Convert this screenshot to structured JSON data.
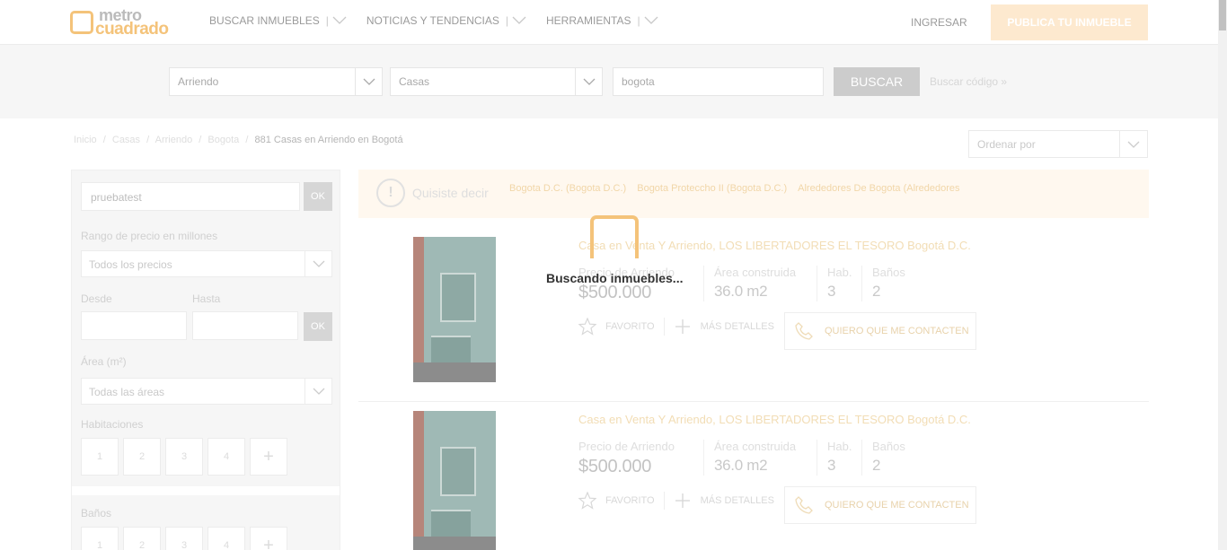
{
  "header": {
    "logo_top": "metro",
    "logo_bottom": "cuadrado",
    "nav": [
      "BUSCAR INMUEBLES",
      "NOTICIAS Y TENDENCIAS",
      "HERRAMIENTAS"
    ],
    "login": "INGRESAR",
    "publish": "PUBLICA TU INMUEBLE"
  },
  "search": {
    "operation": "Arriendo",
    "type": "Casas",
    "location": "bogota",
    "button": "BUSCAR",
    "code_link": "Buscar código »"
  },
  "breadcrumb": [
    "Inicio",
    "/",
    "Casas",
    "/",
    "Arriendo",
    "/",
    "Bogota",
    "/"
  ],
  "breadcrumb_current": "881 Casas en Arriendo en Bogotá",
  "sort": {
    "placeholder": "Ordenar por"
  },
  "filters": {
    "keyword": "pruebatest",
    "ok": "OK",
    "price_label": "Rango de precio en millones",
    "price_value": "Todos los precios",
    "from_label": "Desde",
    "to_label": "Hasta",
    "area_label": "Área (m²)",
    "area_value": "Todas las áreas",
    "rooms_label": "Habitaciones",
    "rooms": [
      "1",
      "2",
      "3",
      "4",
      "+"
    ],
    "baths_label": "Baños",
    "baths": [
      "1",
      "2",
      "3",
      "4",
      "+"
    ]
  },
  "suggestion": {
    "icon": "!",
    "label": "Quisiste decir",
    "links": [
      "Bogota D.C. (Bogota D.C.)",
      "Bogota Proteccho II (Bogota D.C.)",
      "Alrededores De Bogota (Alrededores"
    ]
  },
  "listings": [
    {
      "title": "Casa en Venta Y Arriendo, LOS LIBERTADORES EL TESORO Bogotá D.C.",
      "price_label": "Precio de Arriendo",
      "price": "$500.000",
      "area_label": "Área construida",
      "area": "36.0 m2",
      "rooms_label": "Hab.",
      "rooms": "3",
      "baths_label": "Baños",
      "baths": "2",
      "fav": "FAVORITO",
      "more": "MÁS DETALLES",
      "contact": "QUIERO QUE ME CONTACTEN"
    },
    {
      "title": "Casa en Venta Y Arriendo, LOS LIBERTADORES EL TESORO Bogotá D.C.",
      "price_label": "Precio de Arriendo",
      "price": "$500.000",
      "area_label": "Área construida",
      "area": "36.0 m2",
      "rooms_label": "Hab.",
      "rooms": "3",
      "baths_label": "Baños",
      "baths": "2",
      "fav": "FAVORITO",
      "more": "MÁS DETALLES",
      "contact": "QUIERO QUE ME CONTACTEN"
    }
  ],
  "loader": {
    "text": "Buscando inmuebles..."
  },
  "colors": {
    "accent": "#f4c37a",
    "button_gray": "#cccccc"
  }
}
